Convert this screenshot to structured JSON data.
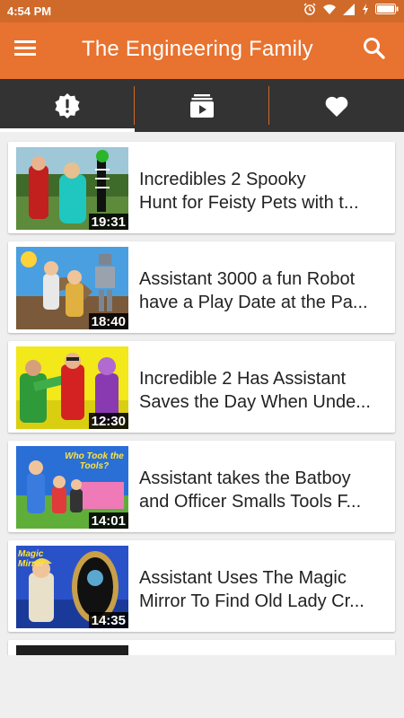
{
  "status_bar": {
    "time": "4:54 PM"
  },
  "app_bar": {
    "title": "The Engineering Family"
  },
  "tabs": [
    {
      "icon": "alert-badge-icon",
      "active": true
    },
    {
      "icon": "subscriptions-icon",
      "active": false
    },
    {
      "icon": "heart-icon",
      "active": false
    }
  ],
  "videos": [
    {
      "title_line1": "Incredibles 2 Spooky",
      "title_line2": "Hunt for Feisty Pets with t...",
      "duration": "19:31"
    },
    {
      "title_line1": "Assistant 3000 a fun Robot",
      "title_line2": "have a Play Date at the Pa...",
      "duration": "18:40"
    },
    {
      "title_line1": "Incredible 2 Has Assistant",
      "title_line2": "Saves the Day When Unde...",
      "duration": "12:30"
    },
    {
      "title_line1": "Assistant takes the Batboy",
      "title_line2": "and Officer Smalls Tools F...",
      "duration": "14:01",
      "thumb_text": "Who Took the Tools?"
    },
    {
      "title_line1": "Assistant Uses The Magic",
      "title_line2": "Mirror To Find Old Lady Cr...",
      "duration": "14:35",
      "thumb_text": "Magic Mirror"
    }
  ],
  "colors": {
    "status_bar": "#d06a2a",
    "app_bar": "#e8722f",
    "tab_bar": "#333333",
    "background": "#efefef"
  }
}
